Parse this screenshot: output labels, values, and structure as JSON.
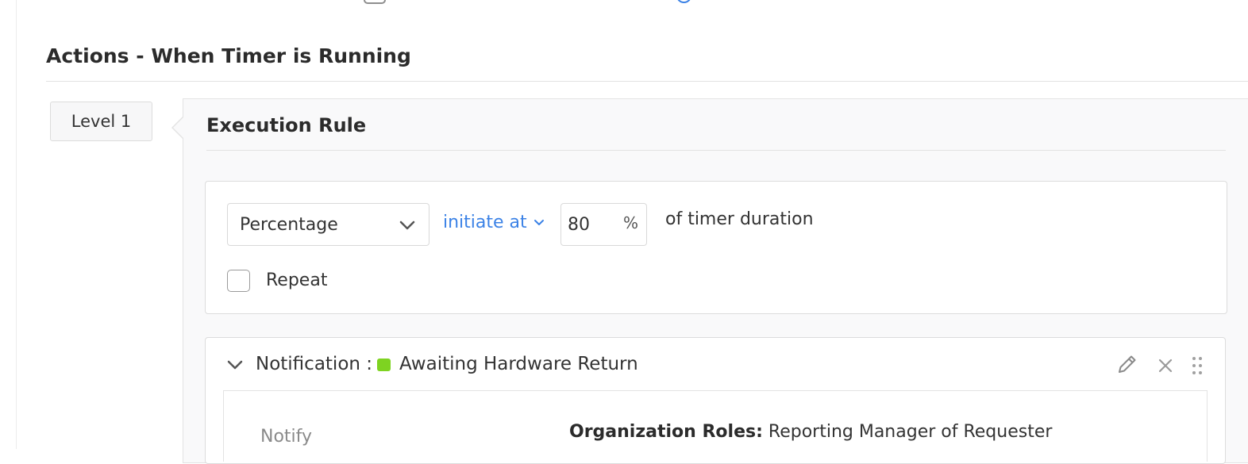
{
  "section": {
    "title": "Actions - When Timer is Running"
  },
  "level_tab": {
    "label": "Level 1"
  },
  "execution_rule": {
    "title": "Execution Rule",
    "type_select": {
      "value": "Percentage"
    },
    "initiate_label": "initiate at",
    "percent_value": "80",
    "percent_sign": "%",
    "duration_text": "of timer duration",
    "repeat_label": "Repeat",
    "repeat_checked": false
  },
  "notification": {
    "label": "Notification :",
    "status_color": "#7ed321",
    "name": "Awaiting Hardware Return",
    "notify_label": "Notify",
    "org_roles_label": "Organization Roles:",
    "org_roles_value": " Reporting Manager of Requester"
  },
  "colors": {
    "accent": "#3b82e6",
    "status_green": "#7ed321"
  },
  "icons": [
    "chevron-down-icon",
    "edit-pencil-icon",
    "close-icon",
    "drag-handle-icon"
  ]
}
